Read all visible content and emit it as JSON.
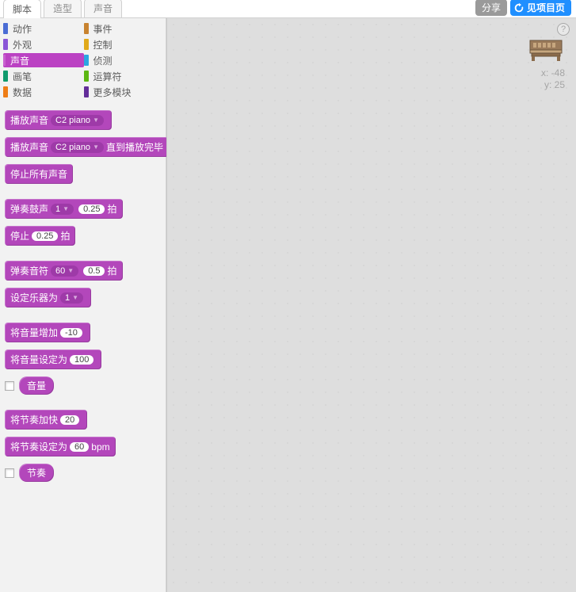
{
  "tabs": {
    "scripts": "脚本",
    "costumes": "造型",
    "sounds": "声音"
  },
  "topright": {
    "share": "分享",
    "project": "见项目页"
  },
  "cats": {
    "motion": "动作",
    "looks": "外观",
    "sound": "声音",
    "pen": "画笔",
    "data": "数据",
    "events": "事件",
    "control": "控制",
    "sensing": "侦测",
    "operators": "运算符",
    "more": "更多模块"
  },
  "blocks": {
    "play_sound": "播放声音",
    "play_sound_opt": "C2 piano",
    "play_sound_until": "播放声音",
    "play_sound_until_opt": "C2 piano",
    "until_done": "直到播放完毕",
    "stop_all": "停止所有声音",
    "play_drum": "弹奏鼓声",
    "drum_num": "1",
    "drum_beats": "0.25",
    "beats_word": "拍",
    "rest": "停止",
    "rest_beats": "0.25",
    "play_note": "弹奏音符",
    "note_num": "60",
    "note_beats": "0.5",
    "set_instr": "设定乐器为",
    "instr_num": "1",
    "change_vol": "将音量增加",
    "change_vol_val": "-10",
    "set_vol": "将音量设定为",
    "set_vol_val": "100",
    "volume": "音量",
    "change_tempo": "将节奏加快",
    "change_tempo_val": "20",
    "set_tempo": "将节奏设定为",
    "set_tempo_val": "60",
    "bpm": "bpm",
    "tempo": "节奏"
  },
  "stage": {
    "x_label": "x:",
    "x_val": "-48",
    "y_label": "y:",
    "y_val": "25"
  }
}
